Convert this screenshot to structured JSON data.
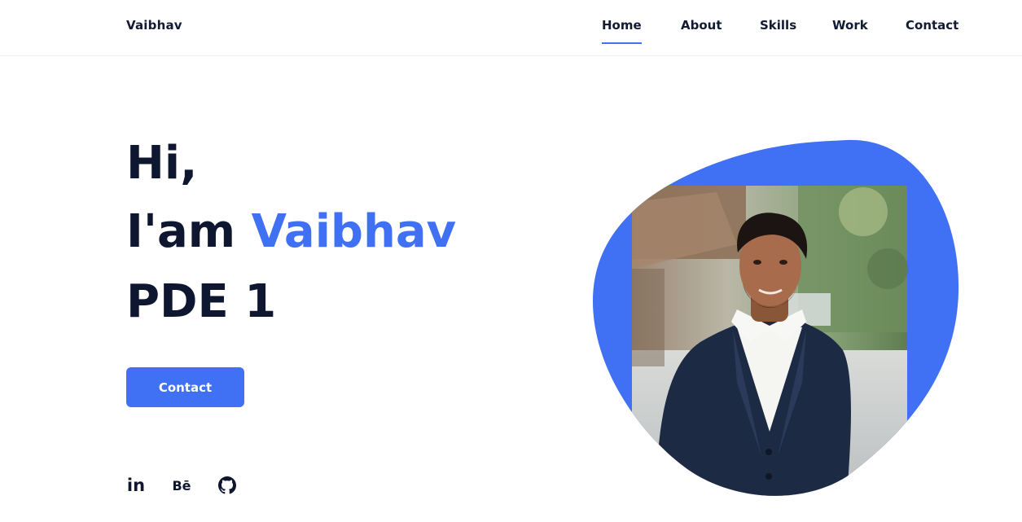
{
  "header": {
    "logo": "Vaibhav",
    "nav": [
      {
        "label": "Home",
        "active": true
      },
      {
        "label": "About",
        "active": false
      },
      {
        "label": "Skills",
        "active": false
      },
      {
        "label": "Work",
        "active": false
      },
      {
        "label": "Contact",
        "active": false
      }
    ]
  },
  "hero": {
    "greeting": "Hi,",
    "intro_prefix": "I'am ",
    "name": "Vaibhav",
    "role": "PDE 1",
    "cta_label": "Contact"
  },
  "social": [
    {
      "icon": "linkedin-icon",
      "label": "in"
    },
    {
      "icon": "behance-icon",
      "label": "Bē"
    },
    {
      "icon": "github-icon",
      "label": ""
    }
  ],
  "colors": {
    "accent": "#4070f4",
    "text": "#0f1730",
    "suit": "#1d2a44",
    "shirt": "#f5f5f2",
    "skin": "#a86b4c"
  }
}
